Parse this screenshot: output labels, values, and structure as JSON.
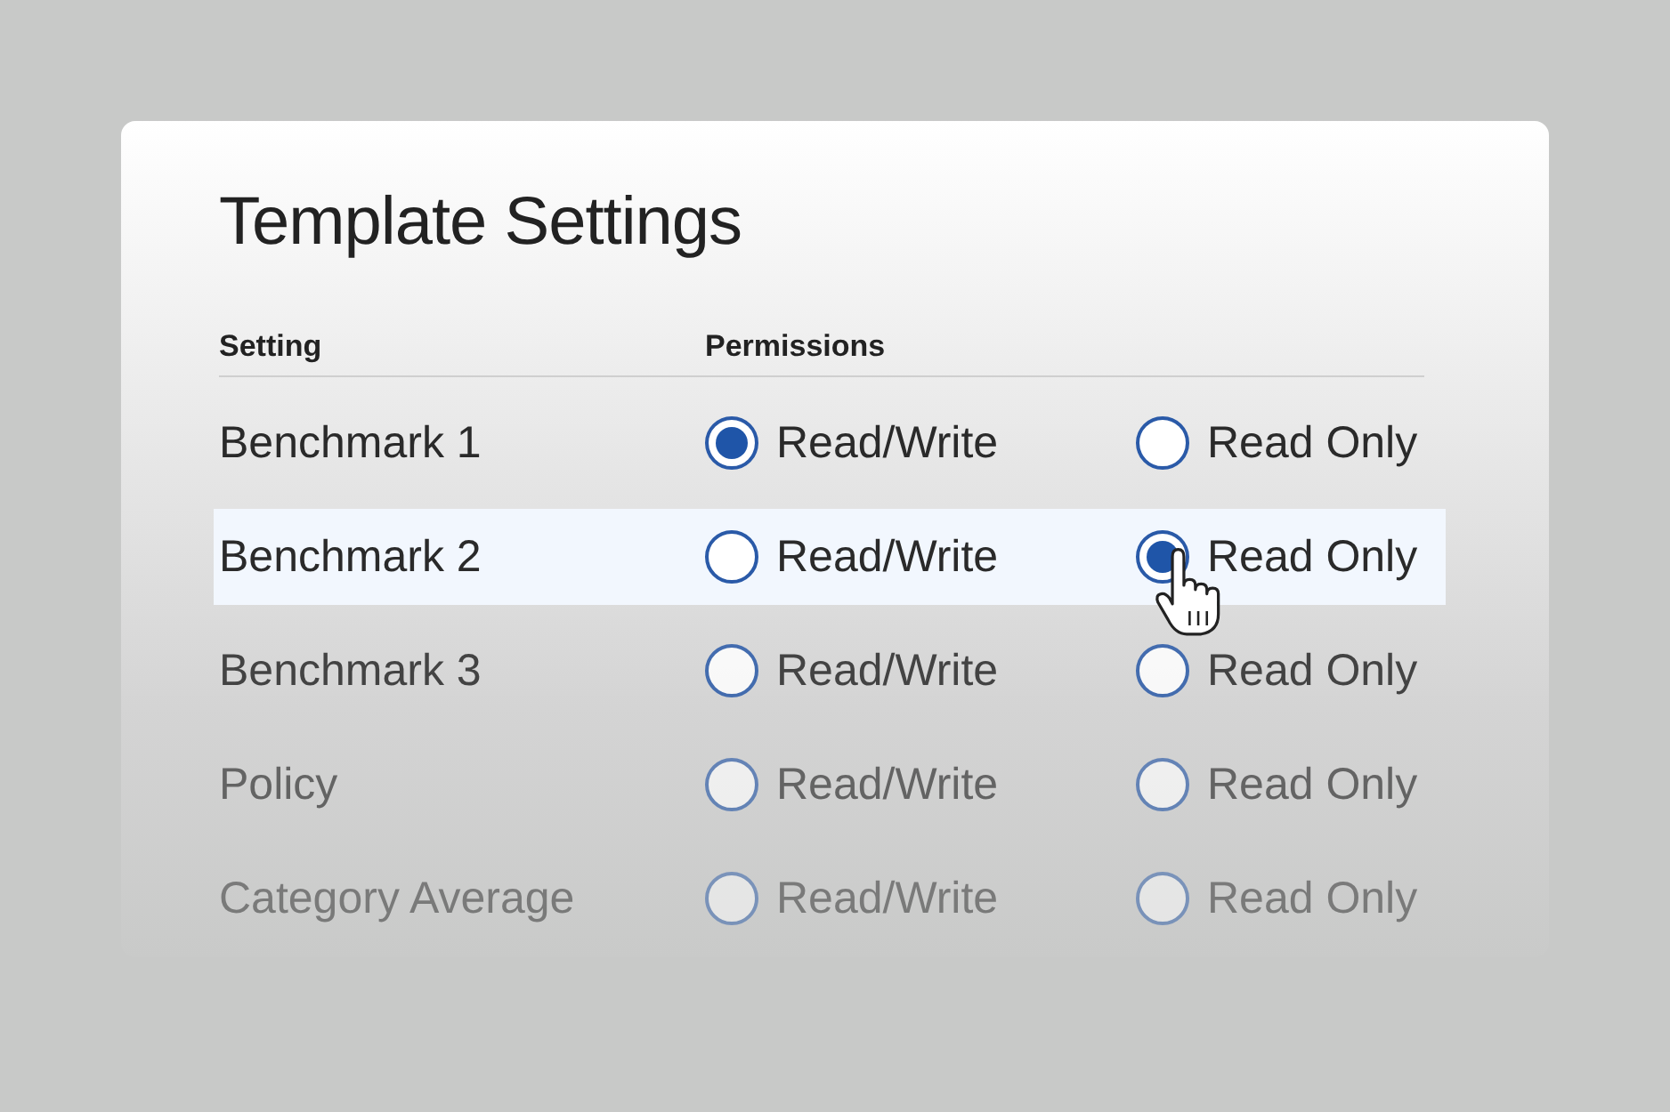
{
  "title": "Template Settings",
  "columns": [
    "Setting",
    "Permissions"
  ],
  "rows": [
    {
      "setting": "Benchmark 1",
      "highlighted": false,
      "options": [
        {
          "label": "Read/Write",
          "selected": true
        },
        {
          "label": "Read Only",
          "selected": false
        }
      ]
    },
    {
      "setting": "Benchmark 2",
      "highlighted": true,
      "options": [
        {
          "label": "Read/Write",
          "selected": false
        },
        {
          "label": "Read Only",
          "selected": true
        }
      ]
    },
    {
      "setting": "Benchmark 3",
      "highlighted": false,
      "options": [
        {
          "label": "Read/Write",
          "selected": false
        },
        {
          "label": "Read Only",
          "selected": false
        }
      ]
    },
    {
      "setting": "Policy",
      "highlighted": false,
      "options": [
        {
          "label": "Read/Write",
          "selected": false
        },
        {
          "label": "Read Only",
          "selected": false
        }
      ]
    },
    {
      "setting": "Category Average",
      "highlighted": false,
      "options": [
        {
          "label": "Read/Write",
          "selected": false
        },
        {
          "label": "Read Only",
          "selected": false
        }
      ]
    }
  ]
}
